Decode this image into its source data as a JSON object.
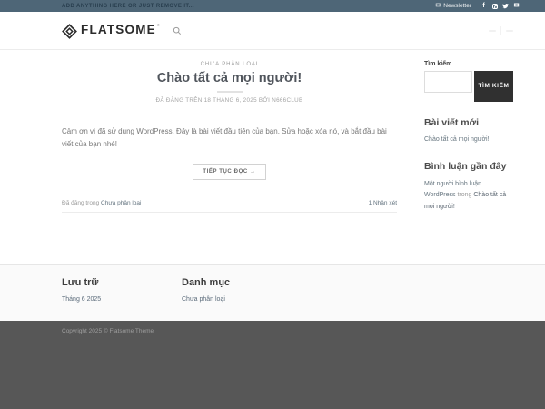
{
  "topbar": {
    "left_text": "ADD ANYTHING HERE OR JUST REMOVE IT...",
    "newsletter_label": "Newsletter",
    "social_icons": [
      "facebook-icon",
      "instagram-icon",
      "twitter-icon",
      "email-icon"
    ]
  },
  "header": {
    "logo_text": "FLATSOME",
    "registered_mark": "®",
    "icons": [
      "diamond-logo-icon",
      "search-icon"
    ]
  },
  "post": {
    "category": "CHƯA PHÂN LOẠI",
    "title": "Chào tất cả mọi người!",
    "meta": "ĐÃ ĐĂNG TRÊN 18 THÁNG 6, 2025 BỞI N666CLUB",
    "excerpt": "Cảm ơn vì đã sử dụng WordPress. Đây là bài viết đầu tiên của bạn. Sửa hoặc xóa nó, và bắt đầu bài viết của bạn nhé!",
    "read_more_label": "TIẾP TỤC ĐỌC →",
    "posted_in_prefix": "Đã đăng trong ",
    "posted_in_category": "Chưa phân loại",
    "comments_label": "1 Nhận xét"
  },
  "sidebar": {
    "search_label": "Tìm kiếm",
    "search_button": "TÌM KIẾM",
    "search_value": "",
    "recent_posts_title": "Bài viết mới",
    "recent_posts": [
      "Chào tất cả mọi người!"
    ],
    "recent_comments_title": "Bình luận gần đây",
    "comment_author": "Một người bình luận WordPress",
    "comment_connector": " trong ",
    "comment_post": "Chào tất cả mọi người!"
  },
  "footer": {
    "archives_title": "Lưu trữ",
    "archives": [
      "Tháng 6 2025"
    ],
    "categories_title": "Danh mục",
    "categories": [
      "Chưa phân loại"
    ],
    "copyright": "Copyright 2025 © Flatsome Theme"
  },
  "colors": {
    "topbar_bg": "#4e6677",
    "search_button_bg": "#303030",
    "footer_dark_bg": "#575757",
    "link": "#62727e",
    "heading": "#50555c"
  }
}
